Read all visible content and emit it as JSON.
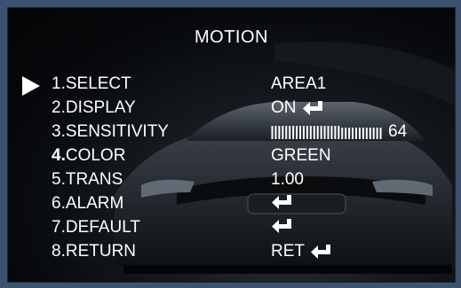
{
  "menu": {
    "title": "MOTION",
    "items": [
      {
        "label": "1.SELECT",
        "value": "AREA1"
      },
      {
        "label": "2.DISPLAY",
        "value": "ON"
      },
      {
        "label": "3.SENSITIVITY",
        "value": "64"
      },
      {
        "label_num": "4.",
        "label_text": "COLOR",
        "value": "GREEN"
      },
      {
        "label": "5.TRANS",
        "value": "1.00"
      },
      {
        "label": "6.ALARM",
        "value": ""
      },
      {
        "label": "7.DEFAULT",
        "value": ""
      },
      {
        "label": "8.RETURN",
        "value": "RET"
      }
    ],
    "sensitivity_level": 64,
    "selected_index": 0
  },
  "colors": {
    "text": "#ffffff",
    "frame": "#3c5270",
    "background": "#07090c"
  },
  "icons": {
    "cursor": "triangle-right-icon",
    "enter": "enter-return-icon"
  }
}
